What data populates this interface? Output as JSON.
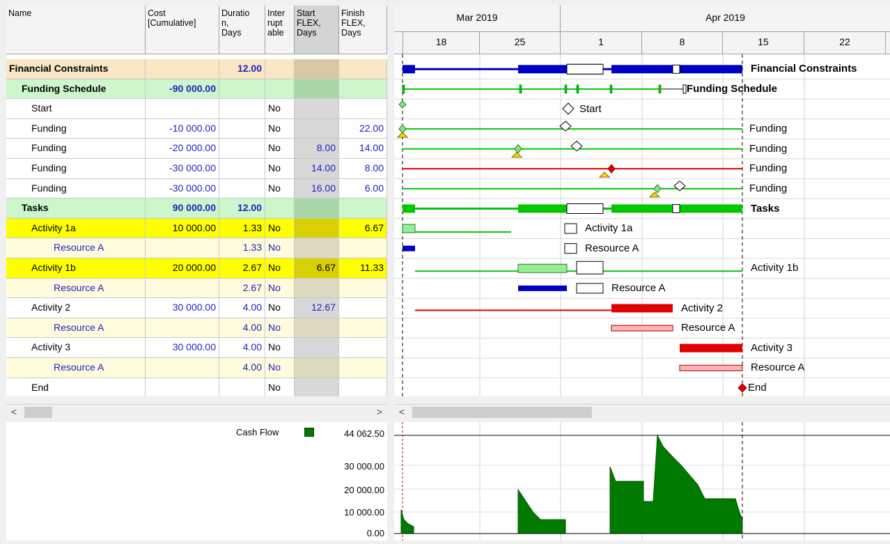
{
  "grid": {
    "columns": [
      {
        "key": "name",
        "label": "Name"
      },
      {
        "key": "cost",
        "label": "Cost\n[Cumulative]"
      },
      {
        "key": "duration",
        "label": "Duratio\nn,\nDays"
      },
      {
        "key": "interruptable",
        "label": "Inter\nrupt\nable"
      },
      {
        "key": "start_flex",
        "label": "Start\nFLEX,\nDays"
      },
      {
        "key": "finish_flex",
        "label": "Finish\nFLEX,\nDays"
      }
    ],
    "rows": [
      {
        "name": "Financial Constraints",
        "cost": "",
        "duration": "12.00",
        "interruptable": "",
        "start_flex": "",
        "finish_flex": "",
        "style": "summary"
      },
      {
        "name": "Funding Schedule",
        "cost": "-90 000.00",
        "duration": "",
        "interruptable": "",
        "start_flex": "",
        "finish_flex": "",
        "style": "group"
      },
      {
        "name": "Start",
        "cost": "",
        "duration": "",
        "interruptable": "No",
        "start_flex": "",
        "finish_flex": "",
        "style": "plain"
      },
      {
        "name": "Funding",
        "cost": "-10 000.00",
        "duration": "",
        "interruptable": "No",
        "start_flex": "",
        "finish_flex": "22.00",
        "style": "plain"
      },
      {
        "name": "Funding",
        "cost": "-20 000.00",
        "duration": "",
        "interruptable": "No",
        "start_flex": "8.00",
        "finish_flex": "14.00",
        "style": "plain"
      },
      {
        "name": "Funding",
        "cost": "-30 000.00",
        "duration": "",
        "interruptable": "No",
        "start_flex": "14.00",
        "finish_flex": "8.00",
        "style": "plain"
      },
      {
        "name": "Funding",
        "cost": "-30 000.00",
        "duration": "",
        "interruptable": "No",
        "start_flex": "16.00",
        "finish_flex": "6.00",
        "style": "plain"
      },
      {
        "name": "Tasks",
        "cost": "90 000.00",
        "duration": "12.00",
        "interruptable": "",
        "start_flex": "",
        "finish_flex": "",
        "style": "group"
      },
      {
        "name": "Activity 1a",
        "cost": "10 000.00",
        "duration": "1.33",
        "interruptable": "No",
        "start_flex": "",
        "finish_flex": "6.67",
        "style": "activity"
      },
      {
        "name": "Resource A",
        "cost": "",
        "duration": "1.33",
        "interruptable": "No",
        "start_flex": "",
        "finish_flex": "",
        "style": "resource"
      },
      {
        "name": "Activity 1b",
        "cost": "20 000.00",
        "duration": "2.67",
        "interruptable": "No",
        "start_flex": "6.67",
        "finish_flex": "11.33",
        "style": "activity"
      },
      {
        "name": "Resource A",
        "cost": "",
        "duration": "2.67",
        "interruptable": "No",
        "start_flex": "",
        "finish_flex": "",
        "style": "resource"
      },
      {
        "name": "Activity 2",
        "cost": "30 000.00",
        "duration": "4.00",
        "interruptable": "No",
        "start_flex": "12.67",
        "finish_flex": "",
        "style": "plain"
      },
      {
        "name": "Resource A",
        "cost": "",
        "duration": "4.00",
        "interruptable": "No",
        "start_flex": "",
        "finish_flex": "",
        "style": "resource"
      },
      {
        "name": "Activity 3",
        "cost": "30 000.00",
        "duration": "4.00",
        "interruptable": "No",
        "start_flex": "",
        "finish_flex": "",
        "style": "plain"
      },
      {
        "name": "Resource A",
        "cost": "",
        "duration": "4.00",
        "interruptable": "No",
        "start_flex": "",
        "finish_flex": "",
        "style": "resource"
      },
      {
        "name": "End",
        "cost": "",
        "duration": "",
        "interruptable": "No",
        "start_flex": "",
        "finish_flex": "",
        "style": "plain"
      }
    ]
  },
  "timeline": {
    "months": [
      "Mar 2019",
      "Apr 2019"
    ],
    "weeks": [
      "18",
      "25",
      "1",
      "8",
      "15",
      "22"
    ]
  },
  "gantt_labels": [
    "Financial Constraints",
    "Funding Schedule",
    "Start",
    "Funding",
    "Funding",
    "Funding",
    "Funding",
    "Tasks",
    "Activity 1a",
    "Resource A",
    "Activity 1b",
    "Resource A",
    "Activity 2",
    "Resource A",
    "Activity 3",
    "Resource A",
    "End"
  ],
  "cashflow": {
    "legend_label": "Cash Flow",
    "legend_color": "#007a00",
    "max_label": "44 062.50",
    "ticks": [
      "30 000.00",
      "20 000.00",
      "10 000.00",
      "0.00"
    ]
  },
  "colors": {
    "summary_bg": "#f8e6c4",
    "group_bg": "#ccf7cc",
    "activity_bg": "#ffff00",
    "resource_bg": "#fffbdc",
    "flex_col": "#d8d8d8",
    "blue": "#0000c0",
    "green": "#00c800",
    "red": "#e00000",
    "pink": "#ffb4b4",
    "light_green": "#98ec98",
    "text_blue": "#2020c0"
  },
  "scroll": {
    "left_arrow": "<",
    "right_arrow": ">"
  }
}
